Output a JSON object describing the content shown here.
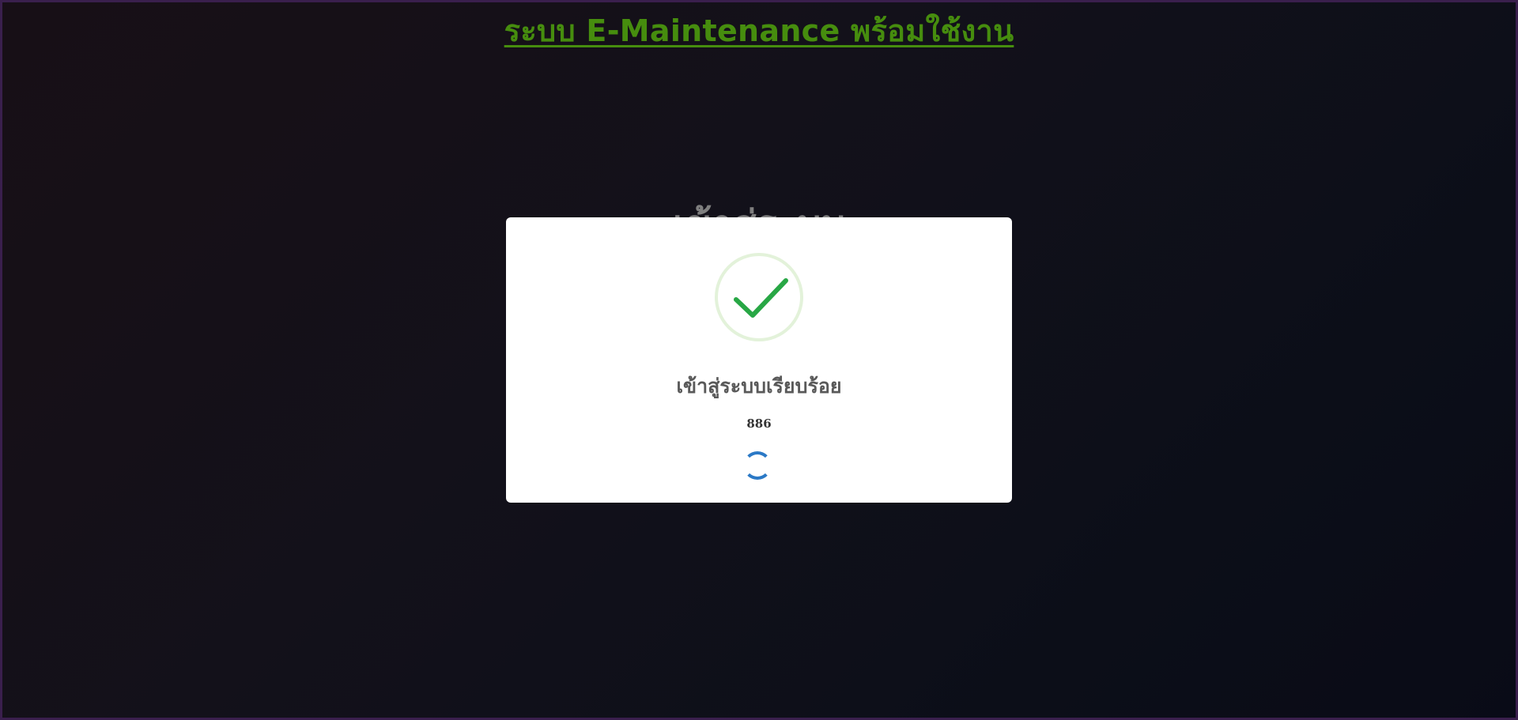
{
  "page": {
    "title": "ระบบ E-Maintenance พร้อมใช้งาน",
    "login_heading": "เข้าสู่ระบบ"
  },
  "modal": {
    "icon": "success-check-icon",
    "title": "เข้าสู่ระบบเรียบร้อย",
    "text": "886",
    "loader": "loading-spinner"
  },
  "colors": {
    "title_green": "#4d9a10",
    "check_green": "#28a745",
    "check_ring": "#e3f2da",
    "spinner_blue": "#2b79c6",
    "modal_bg": "#ffffff"
  }
}
